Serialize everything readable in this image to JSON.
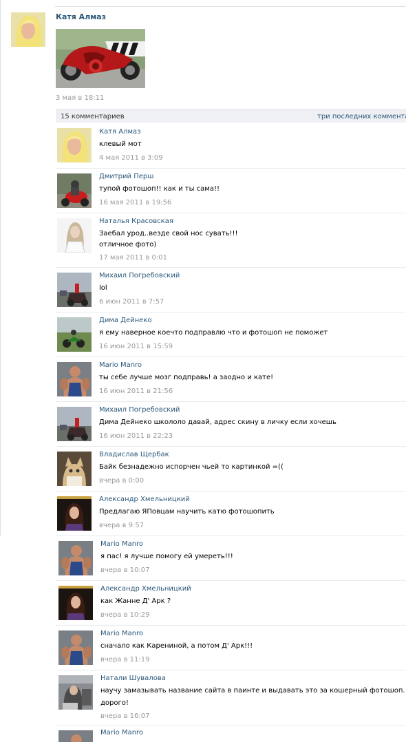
{
  "post": {
    "author": "Катя Алмаз",
    "date": "3 мая в 18:11"
  },
  "comments_header": {
    "count": "15 комментариев",
    "last_link": "три последних комментар"
  },
  "comments": [
    {
      "author": "Катя Алмаз",
      "text": "клевый мот",
      "date": "4 мая 2011 в 3:09"
    },
    {
      "author": "Дмитрий Перш",
      "text": "тупой фотошоп!! как и ты сама!!",
      "date": "16 мая 2011 в 19:56"
    },
    {
      "author": "Наталья Красовская",
      "text": "Заебал урод..везде свой нос сувать!!!",
      "text2": "отличное фото)",
      "date": "17 мая 2011 в 0:01"
    },
    {
      "author": "Михаил Погребовский",
      "text": "lol",
      "date": "6 июн 2011 в 7:57"
    },
    {
      "author": "Дима Дейнеко",
      "text": "я ему наверное коечто подправлю что и фотошоп не поможет",
      "date": "16 июн 2011 в 15:59"
    },
    {
      "author": "Mario Manro",
      "text": "ты себе лучше мозг подправь! а заодно и кате!",
      "date": "16 июн 2011 в 21:56"
    },
    {
      "author": "Михаил Погребовский",
      "text": "Дима Дейнеко школоло давай, адрес скину в личку если хочешь",
      "date": "16 июн 2011 в 22:23"
    },
    {
      "author": "Владислав Щербак",
      "text": "Байк безнадежно испорчен чьей то картинкой =((",
      "date": "вчера в 0:00"
    },
    {
      "author": "Александр Хмельницкий",
      "text": "Предлагаю ЯПовцам научить катю фотошопить",
      "date": "вчера в 9:57"
    },
    {
      "author": "Mario Manro",
      "text": "я пас! я лучше помогу ей умереть!!!",
      "date": "вчера в 10:07"
    },
    {
      "author": "Александр Хмельницкий",
      "text": "как Жанне Д' Арк ?",
      "date": "вчера в 10:29"
    },
    {
      "author": "Mario Manro",
      "text": "сначало как Карениной, а потом Д' Арк!!!",
      "date": "вчера в 11:19"
    },
    {
      "author": "Натали Шувалова",
      "text": "научу замазывать название сайта в паинте и выдавать это за кошерный фотошоп.",
      "text2": "дорого!",
      "date": "вчера в 16:07"
    },
    {
      "author": "Mario Manro"
    }
  ]
}
